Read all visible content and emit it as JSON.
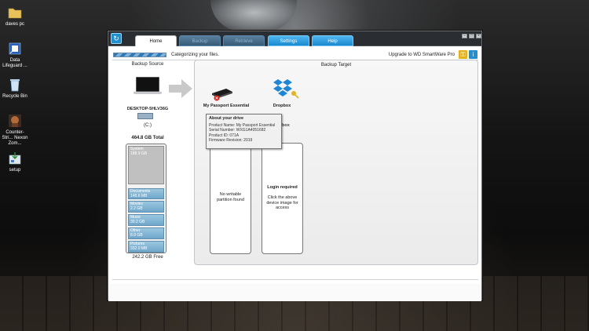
{
  "desktop": {
    "icons": [
      {
        "id": "daves-pc",
        "label": "daves pc",
        "icon": "folder-icon"
      },
      {
        "id": "data-lifeguard",
        "label": "Data Lifeguard ...",
        "icon": "disk-utility-icon"
      },
      {
        "id": "recycle-bin",
        "label": "Recycle Bin",
        "icon": "recycle-bin-icon"
      },
      {
        "id": "counter-strike",
        "label": "Counter-Stri... Nexon Zom...",
        "icon": "game-icon"
      },
      {
        "id": "setup",
        "label": "setup",
        "icon": "installer-icon"
      }
    ]
  },
  "app": {
    "tabs": [
      {
        "label": "Home",
        "state": "active"
      },
      {
        "label": "Backup",
        "state": "disabled"
      },
      {
        "label": "Retrieve",
        "state": "disabled"
      },
      {
        "label": "Settings",
        "state": "enabled"
      },
      {
        "label": "Help",
        "state": "enabled"
      }
    ],
    "window_buttons": [
      "–",
      "□",
      "×"
    ],
    "status_text": "Categorizing your files.",
    "progress_percent": 100,
    "upgrade_text": "Upgrade to WD SmartWare Pro",
    "colors": {
      "accent": "#1a8ad0",
      "titlebar": "#2a2d31",
      "category": "#6fa7cb"
    }
  },
  "backup_source": {
    "title": "Backup Source",
    "computer_name": "DESKTOP-5HLV36G",
    "drive_label": "(C:)",
    "total": "464.8 GB Total",
    "free": "242.2 GB Free",
    "categories": [
      {
        "name": "System",
        "size": "188.9 GB"
      },
      {
        "name": "Documents",
        "size": "148.6 MB"
      },
      {
        "name": "Movies",
        "size": "2.2 GB"
      },
      {
        "name": "Music",
        "size": "30.2 GB"
      },
      {
        "name": "Other",
        "size": "8.9 GB"
      },
      {
        "name": "Pictures",
        "size": "332.0 MB"
      }
    ]
  },
  "backup_target": {
    "title": "Backup Target",
    "devices": [
      {
        "name": "My Passport Essential",
        "icon": "external-drive-icon",
        "status_text": "No writable partition found"
      },
      {
        "name": "Dropbox",
        "icon": "dropbox-icon",
        "status_heading": "Login required",
        "status_text": "Click the above device image for access"
      }
    ],
    "tooltip": {
      "title": "About your drive",
      "lines": [
        "Product Name: My Passport Essential",
        "Serial Number: WXG1A4051682",
        "Product ID: 071A",
        "Firmware Revision: 2019"
      ]
    },
    "partial_label": "box"
  }
}
